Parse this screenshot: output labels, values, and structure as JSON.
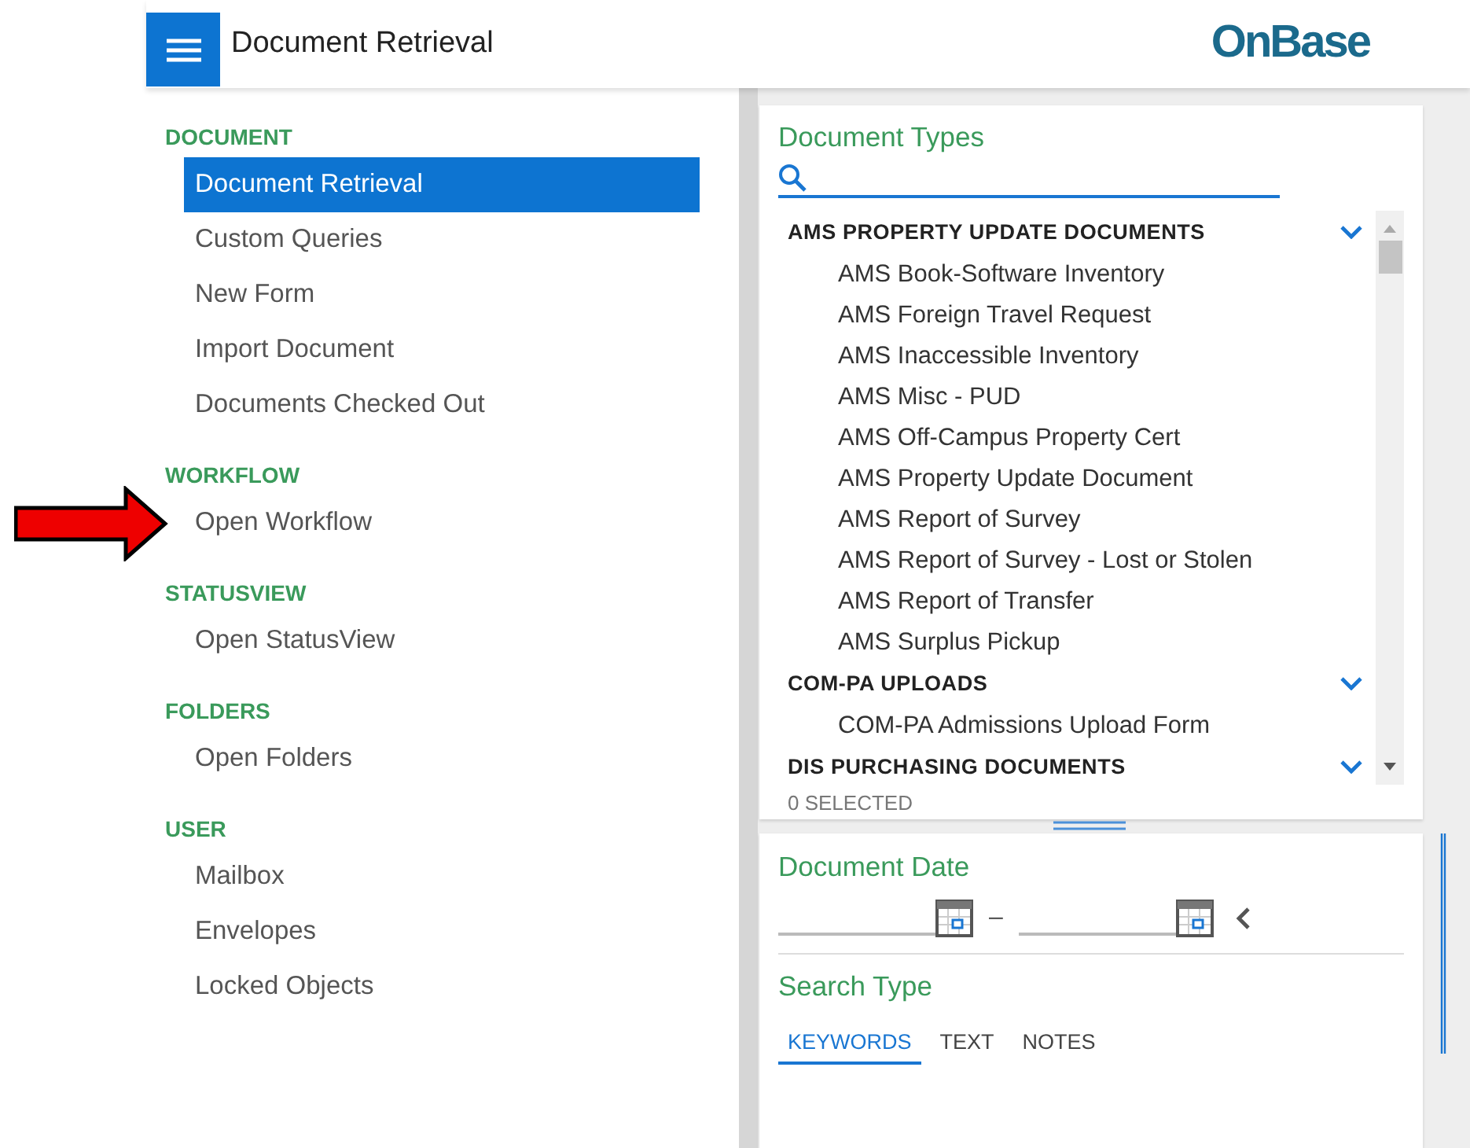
{
  "header": {
    "title": "Document Retrieval",
    "logo": "OnBase"
  },
  "sidebar": {
    "sections": [
      {
        "title": "DOCUMENT",
        "items": [
          {
            "label": "Document Retrieval",
            "selected": true
          },
          {
            "label": "Custom Queries",
            "selected": false
          },
          {
            "label": "New Form",
            "selected": false
          },
          {
            "label": "Import Document",
            "selected": false
          },
          {
            "label": "Documents Checked Out",
            "selected": false
          }
        ]
      },
      {
        "title": "WORKFLOW",
        "items": [
          {
            "label": "Open Workflow",
            "selected": false,
            "pointed": true
          }
        ]
      },
      {
        "title": "STATUSVIEW",
        "items": [
          {
            "label": "Open StatusView",
            "selected": false
          }
        ]
      },
      {
        "title": "FOLDERS",
        "items": [
          {
            "label": "Open Folders",
            "selected": false
          }
        ]
      },
      {
        "title": "USER",
        "items": [
          {
            "label": "Mailbox",
            "selected": false
          },
          {
            "label": "Envelopes",
            "selected": false
          },
          {
            "label": "Locked Objects",
            "selected": false
          }
        ]
      }
    ]
  },
  "document_types": {
    "title": "Document Types",
    "groups": [
      {
        "name": "AMS PROPERTY UPDATE DOCUMENTS",
        "items": [
          "AMS Book-Software Inventory",
          "AMS Foreign Travel Request",
          "AMS Inaccessible Inventory",
          "AMS Misc - PUD",
          "AMS Off-Campus Property Cert",
          "AMS Property Update Document",
          "AMS Report of Survey",
          "AMS Report of Survey - Lost or Stolen",
          "AMS Report of Transfer",
          "AMS Surplus Pickup"
        ]
      },
      {
        "name": "COM-PA UPLOADS",
        "items": [
          "COM-PA Admissions Upload Form"
        ]
      },
      {
        "name": "DIS PURCHASING DOCUMENTS"
      }
    ],
    "selected_count": "0 SELECTED"
  },
  "document_date": {
    "title": "Document Date",
    "separator": "–"
  },
  "search_type": {
    "title": "Search Type",
    "tabs": [
      {
        "label": "KEYWORDS",
        "selected": true
      },
      {
        "label": "TEXT",
        "selected": false
      },
      {
        "label": "NOTES",
        "selected": false
      }
    ]
  }
}
